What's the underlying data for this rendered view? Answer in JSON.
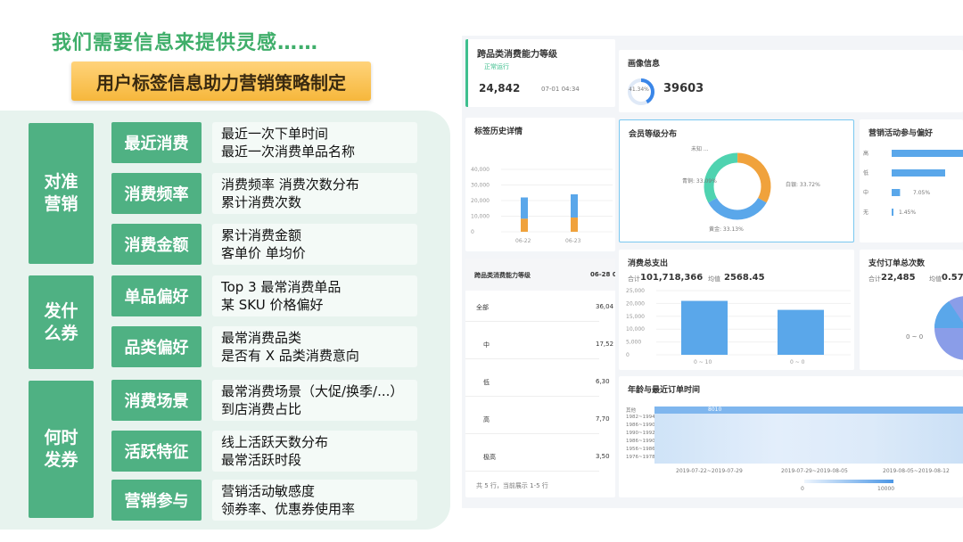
{
  "headline": "我们需要信息来提供灵感……",
  "banner": "用户标签信息助力营销策略制定",
  "groups": [
    {
      "label": "对准\n营销",
      "tags": [
        {
          "name": "最近消费",
          "lines": [
            "最近一次下单时间",
            "最近一次消费单品名称"
          ]
        },
        {
          "name": "消费频率",
          "lines": [
            "消费频率 消费次数分布",
            "累计消费次数"
          ]
        },
        {
          "name": "消费金额",
          "lines": [
            "累计消费金额",
            "客单价 单均价"
          ]
        }
      ]
    },
    {
      "label": "发什\n么券",
      "tags": [
        {
          "name": "单品偏好",
          "lines": [
            "Top 3 最常消费单品",
            "某 SKU 价格偏好"
          ]
        },
        {
          "name": "品类偏好",
          "lines": [
            "最常消费品类",
            "是否有 X 品类消费意向"
          ]
        }
      ]
    },
    {
      "label": "何时\n发券",
      "tags": [
        {
          "name": "消费场景",
          "lines": [
            "最常消费场景（大促/换季/...）",
            "到店消费占比"
          ]
        },
        {
          "name": "活跃特征",
          "lines": [
            "线上活跃天数分布",
            "最常活跃时段"
          ]
        },
        {
          "name": "营销参与",
          "lines": [
            "营销活动敏感度",
            "领券率、优惠券使用率"
          ]
        }
      ]
    }
  ],
  "dashboard": {
    "main_title": "跨品类消费能力等级",
    "main_status": "正常运行",
    "main_count": "24,842",
    "main_date": "07-01 04:34",
    "profile_title": "画像信息",
    "profile_pct": "41.34%",
    "profile_value": "39603",
    "history_title": "标签历史详情",
    "history_yticks": [
      "40,000",
      "30,000",
      "20,000",
      "10,000",
      "0"
    ],
    "history_xticks": [
      "06-22",
      "06-23"
    ],
    "member_title": "会员等级分布",
    "member_labels": [
      "未知 ...",
      "青铜: 33.09%",
      "白银: 33.72%",
      "黄金: 33.13%"
    ],
    "marketing_title": "营销活动参与偏好",
    "marketing_labels": [
      "高",
      "低",
      "中",
      "无"
    ],
    "marketing_values": [
      "7.05%",
      "1.45%"
    ],
    "table_header": "跨品类消费能力等级",
    "table_header_col2": "06-28 0",
    "table_rows": [
      {
        "name": "全部",
        "value": "36,04"
      },
      {
        "name": "中",
        "value": "17,52"
      },
      {
        "name": "低",
        "value": "6,30"
      },
      {
        "name": "高",
        "value": "7,70"
      },
      {
        "name": "极高",
        "value": "3,50"
      }
    ],
    "table_footer": "共 5 行，当前展示 1-5 行",
    "spend_title": "消费总支出",
    "spend_total": "101,718,366",
    "spend_avg": "2568.45",
    "spend_total_prefix": "合计",
    "spend_avg_prefix": "均值",
    "spend_yticks": [
      "25,000",
      "20,000",
      "15,000",
      "10,000",
      "5,000",
      "0"
    ],
    "spend_xticks": [
      "0 ~ 10",
      "0 ~ 0"
    ],
    "orders_title": "支付订单总次数",
    "orders_total": "22,485",
    "orders_avg": "0.57",
    "orders_pie_label": "0 ~ 0",
    "heat_title": "年龄与最近订单时间",
    "heat_rows": [
      "其他",
      "1982~1994",
      "1986~1990",
      "1990~1992",
      "1986~1990",
      "1956~1986",
      "1976~1978"
    ],
    "heat_xticks": [
      "2019-07-22~2019-07-29",
      "2019-07-29~2019-08-05",
      "2019-08-05~2019-08-12"
    ],
    "heat_scale": [
      "0",
      "10000"
    ],
    "heat_col": "8010"
  },
  "chart_data": [
    {
      "type": "bar",
      "title": "标签历史详情",
      "categories": [
        "06-22",
        "06-23"
      ],
      "ylim": [
        0,
        40000
      ],
      "series": [
        {
          "values": [
            22000,
            24000
          ]
        }
      ]
    },
    {
      "type": "pie",
      "title": "会员等级分布",
      "categories": [
        "未知",
        "青铜",
        "白银",
        "黄金"
      ],
      "values": [
        0.06,
        33.09,
        33.72,
        33.13
      ]
    },
    {
      "type": "bar",
      "title": "营销活动参与偏好",
      "categories": [
        "高",
        "低",
        "中",
        "无"
      ],
      "values": [
        60,
        45,
        7.05,
        1.45
      ]
    },
    {
      "type": "bar",
      "title": "消费总支出",
      "categories": [
        "0 ~ 10",
        "0 ~ 0"
      ],
      "ylim": [
        0,
        25000
      ],
      "values": [
        21000,
        17500
      ]
    }
  ],
  "colors": {
    "green": "#4fb183",
    "headline": "#3fae6a",
    "banner": "#f6b73c",
    "blue": "#5aa7ea",
    "orange": "#f0a23c",
    "teal": "#4fd3b0"
  }
}
